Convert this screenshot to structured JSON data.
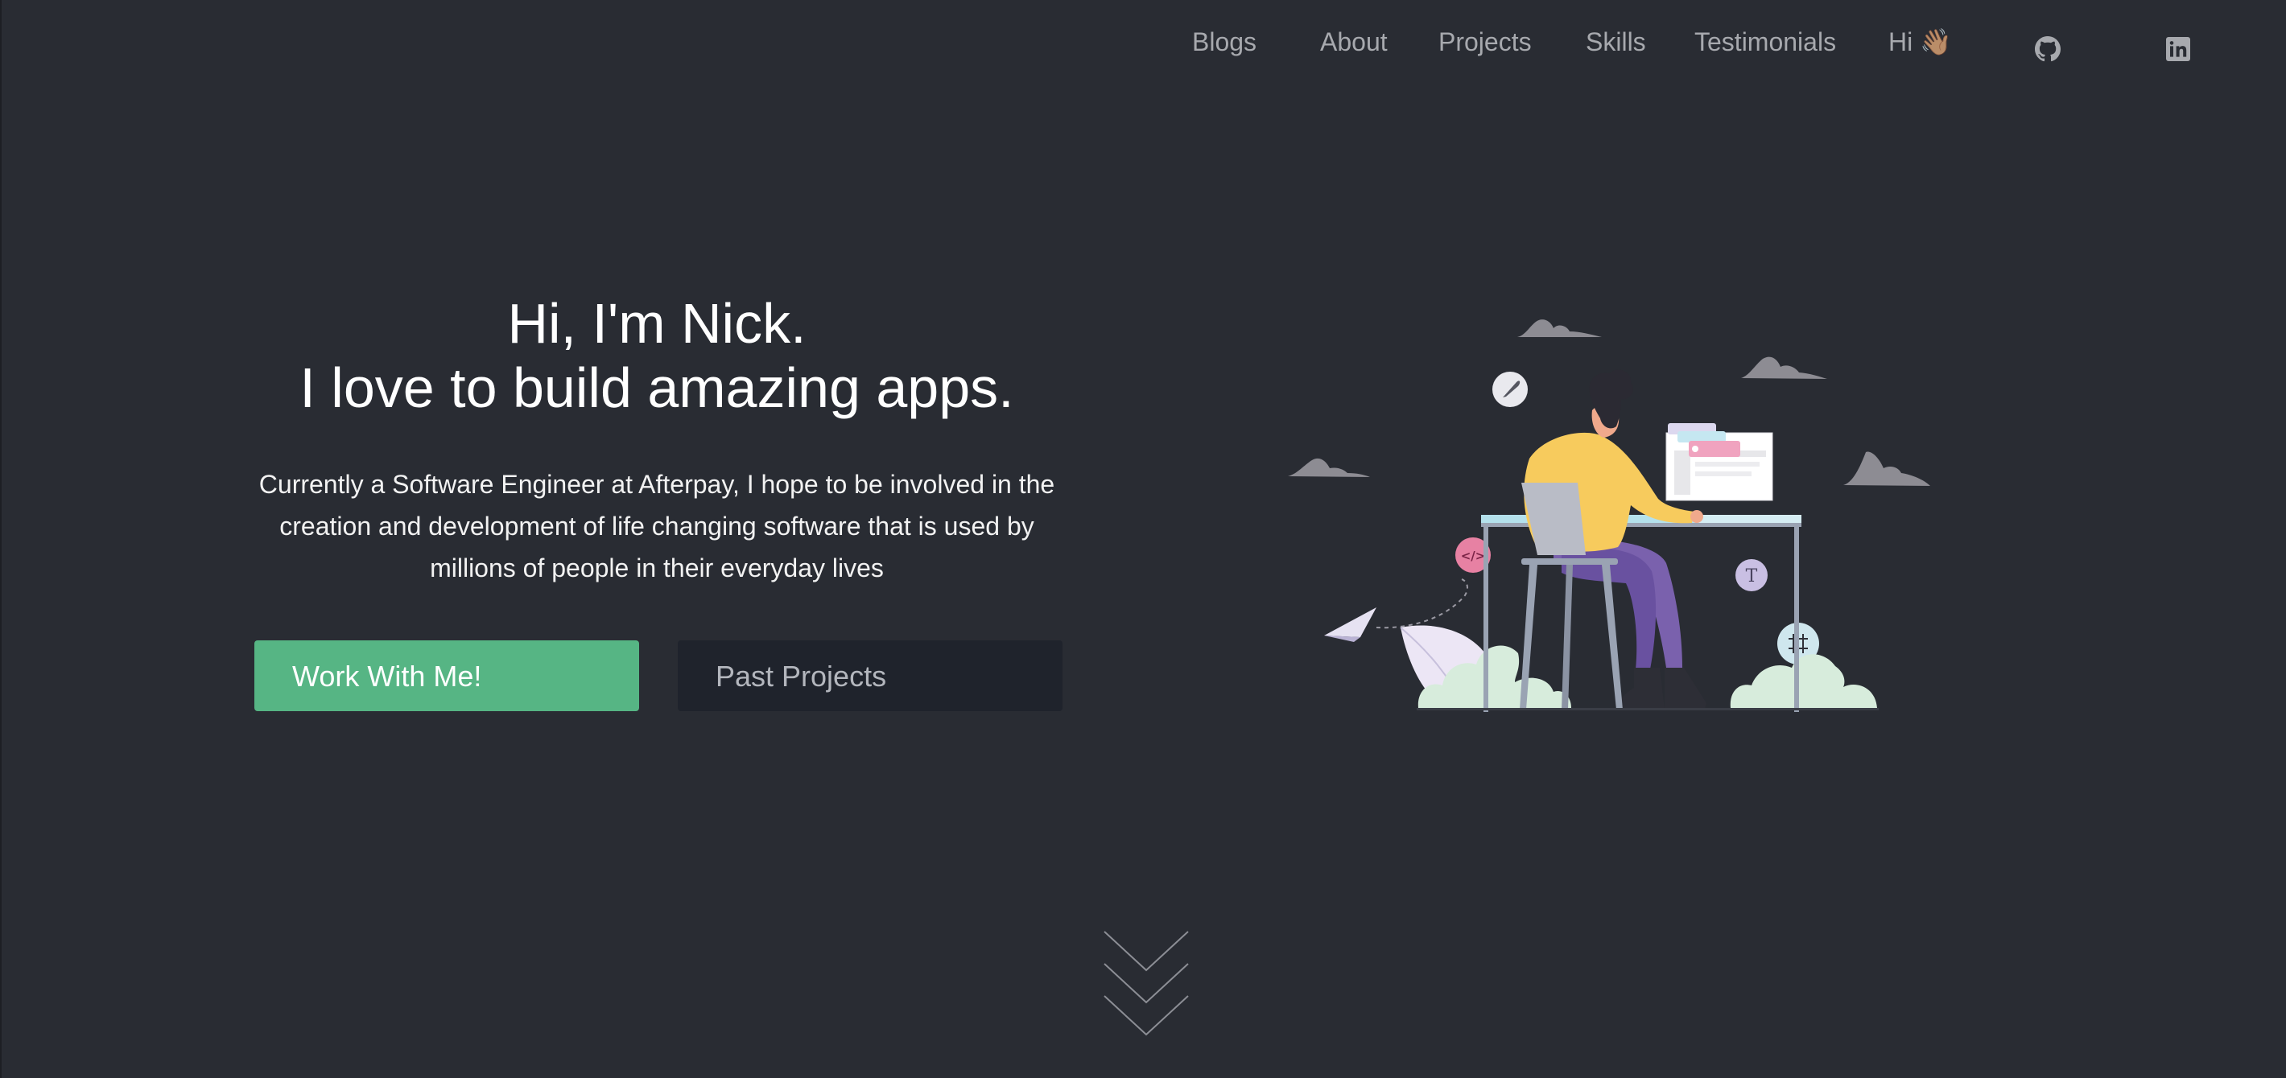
{
  "nav": {
    "items": [
      {
        "label": "Blogs"
      },
      {
        "label": "About"
      },
      {
        "label": "Projects"
      },
      {
        "label": "Skills"
      },
      {
        "label": "Testimonials"
      },
      {
        "label": "Hi 👋🏽"
      }
    ],
    "github_icon": "github-icon",
    "linkedin_icon": "linkedin-icon"
  },
  "hero": {
    "title_line1": "Hi, I'm Nick.",
    "title_line2": "I love to build amazing apps.",
    "subtitle": "Currently a Software Engineer at Afterpay, I hope to be involved in the creation and development of life changing software that is used by millions of people in their everyday lives",
    "primary_button": "Work With Me!",
    "secondary_button": "Past Projects"
  },
  "illustration": {
    "badge_code": "</>",
    "badge_type": "T"
  },
  "colors": {
    "background": "#292c33",
    "accent": "#56b584",
    "nav_text": "#a7a9ae",
    "secondary_button": "#1f232c"
  }
}
